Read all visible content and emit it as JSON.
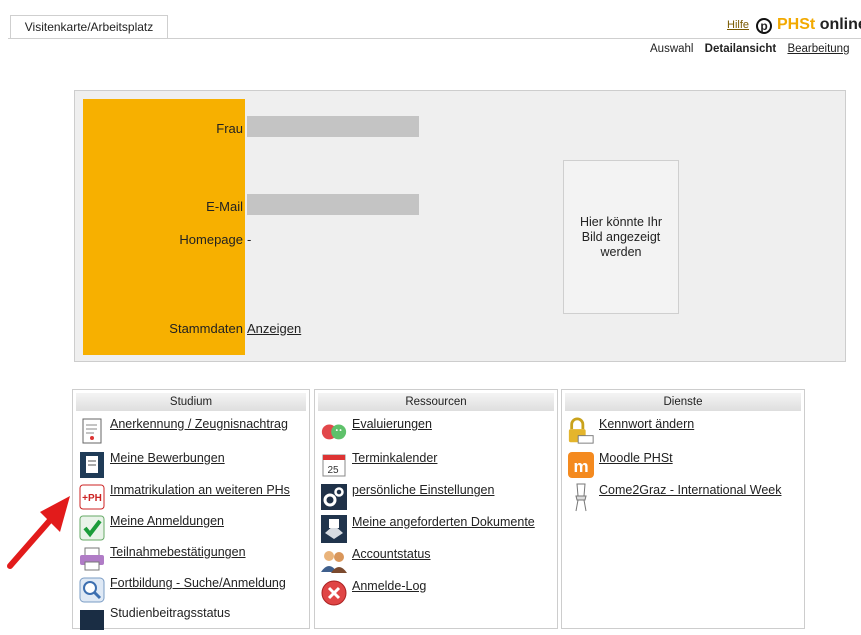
{
  "header": {
    "tab_label": "Visitenkarte/Arbeitsplatz",
    "help_label": "Hilfe",
    "logo_icon_letter": "p",
    "logo_part1": "PHSt",
    "logo_part2": "online",
    "subnav": [
      "Auswahl",
      "Detailansicht",
      "Bearbeitung"
    ]
  },
  "profile": {
    "salutation_label": "Frau",
    "email_label": "E-Mail",
    "homepage_label": "Homepage",
    "homepage_value": "-",
    "stammdaten_label": "Stammdaten",
    "stammdaten_link": "Anzeigen",
    "photo_placeholder": "Hier könnte Ihr Bild angezeigt werden"
  },
  "columns": {
    "studium": {
      "title": "Studium",
      "items": [
        {
          "label": "Anerkennung / Zeugnisnachtrag",
          "icon": "document-icon"
        },
        {
          "label": "Meine Bewerbungen",
          "icon": "application-icon"
        },
        {
          "label": "Immatrikulation an weiteren PHs",
          "icon": "plus-ph-icon"
        },
        {
          "label": "Meine Anmeldungen",
          "icon": "checkmark-icon"
        },
        {
          "label": "Teilnahmebestätigungen",
          "icon": "printer-icon"
        },
        {
          "label": "Fortbildung - Suche/Anmeldung",
          "icon": "magnifier-icon"
        },
        {
          "label": "Studienbeitragsstatus",
          "icon": "monitor-icon"
        }
      ]
    },
    "ressourcen": {
      "title": "Ressourcen",
      "calendar_day": "25",
      "items": [
        {
          "label": "Evaluierungen",
          "icon": "smiley-icon"
        },
        {
          "label": "Terminkalender",
          "icon": "calendar-icon"
        },
        {
          "label": "persönliche Einstellungen",
          "icon": "gears-icon"
        },
        {
          "label": "Meine angeforderten Dokumente",
          "icon": "document-request-icon"
        },
        {
          "label": "Accountstatus",
          "icon": "users-icon"
        },
        {
          "label": "Anmelde-Log",
          "icon": "close-circle-icon"
        }
      ]
    },
    "dienste": {
      "title": "Dienste",
      "items": [
        {
          "label": "Kennwort ändern",
          "icon": "lock-icon"
        },
        {
          "label": "Moodle PHSt",
          "icon": "moodle-icon"
        },
        {
          "label": "Come2Graz - International Week",
          "icon": "chair-icon"
        }
      ]
    }
  },
  "colors": {
    "orange": "#f7b000",
    "card": "#efefef",
    "arrow": "#e21b1b"
  }
}
